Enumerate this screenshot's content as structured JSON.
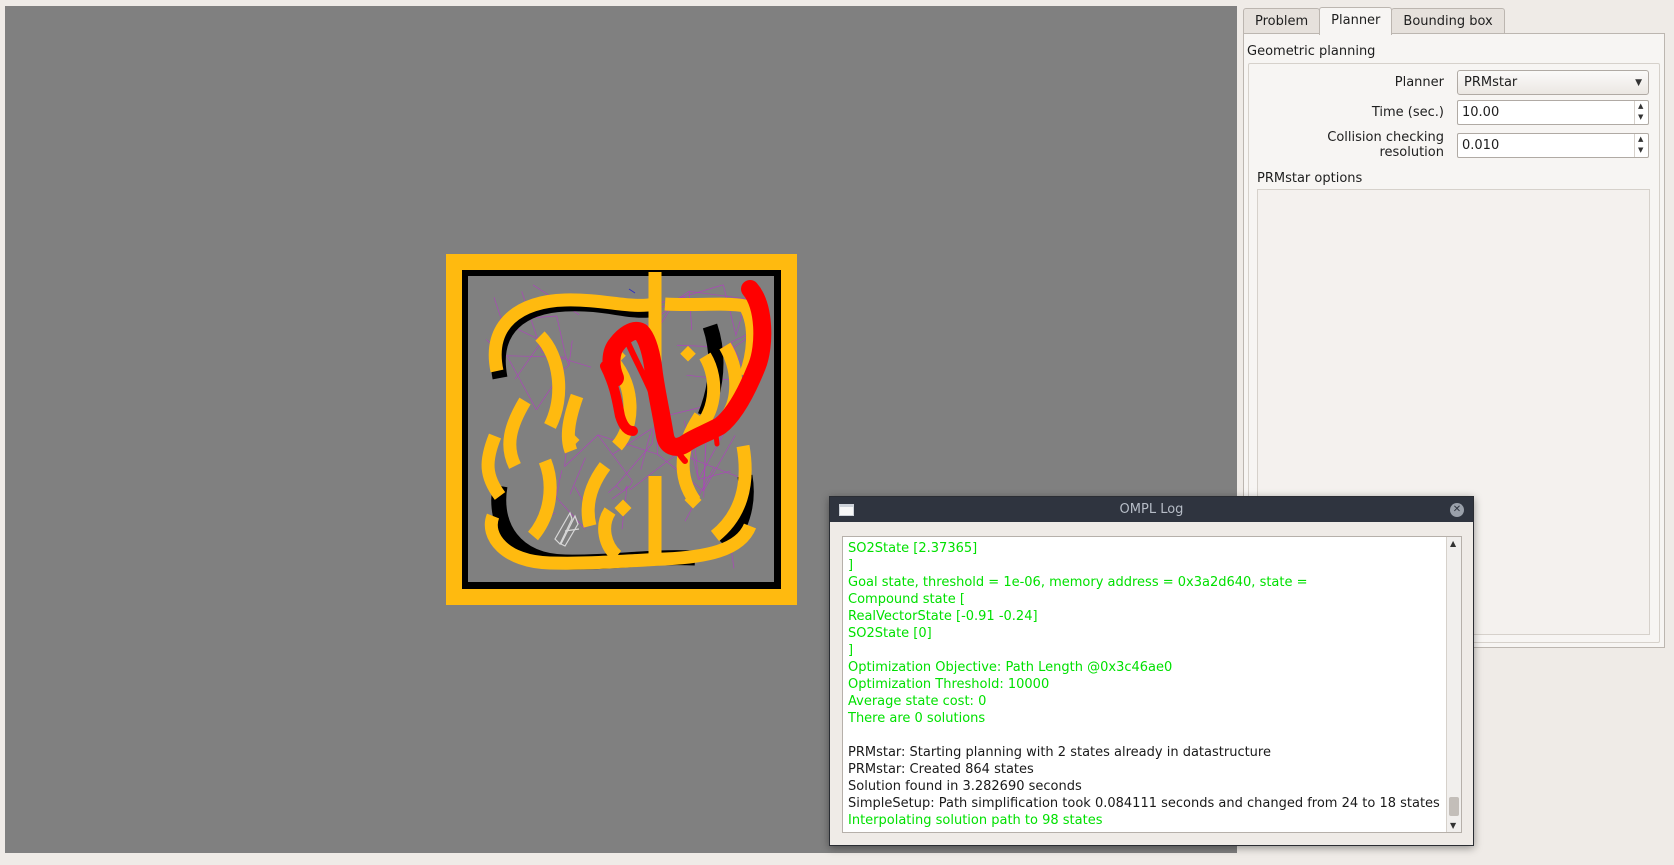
{
  "tabs": [
    {
      "label": "Problem"
    },
    {
      "label": "Planner",
      "active": true
    },
    {
      "label": "Bounding box"
    }
  ],
  "planner_tab": {
    "group_title": "Geometric planning",
    "planner_label": "Planner",
    "planner_value": "PRMstar",
    "time_label": "Time (sec.)",
    "time_value": "10.00",
    "collision_label_line1": "Collision checking",
    "collision_label_line2": "resolution",
    "collision_value": "0.010",
    "options_title": "PRMstar options"
  },
  "scene": {
    "border_color": "#ffba0f",
    "wall_color": "#000000",
    "floor_color": "#808080",
    "roadmap_color": "#b040c0",
    "path_color": "#ff0000",
    "robot_outline_color": "#d8d8d8"
  },
  "log_window": {
    "title": "OMPL Log",
    "lines": [
      {
        "text": "SO2State [2.37365]",
        "level": "info"
      },
      {
        "text": "]",
        "level": "info"
      },
      {
        "text": "Goal state, threshold = 1e-06, memory address = 0x3a2d640, state =",
        "level": "info"
      },
      {
        "text": "Compound state [",
        "level": "info"
      },
      {
        "text": "RealVectorState [-0.91 -0.24]",
        "level": "info"
      },
      {
        "text": "SO2State [0]",
        "level": "info"
      },
      {
        "text": "]",
        "level": "info"
      },
      {
        "text": "Optimization Objective: Path Length @0x3c46ae0",
        "level": "info"
      },
      {
        "text": "Optimization Threshold: 10000",
        "level": "info"
      },
      {
        "text": "Average state cost: 0",
        "level": "info"
      },
      {
        "text": "There are 0 solutions",
        "level": "info"
      },
      {
        "text": "",
        "level": "plain"
      },
      {
        "text": "PRMstar: Starting planning with 2 states already in datastructure",
        "level": "plain"
      },
      {
        "text": "PRMstar: Created 864 states",
        "level": "plain"
      },
      {
        "text": "Solution found in 3.282690 seconds",
        "level": "plain"
      },
      {
        "text": "SimpleSetup: Path simplification took 0.084111 seconds and changed from 24 to 18 states",
        "level": "plain"
      },
      {
        "text": "Interpolating solution path to 98 states",
        "level": "info"
      }
    ]
  }
}
